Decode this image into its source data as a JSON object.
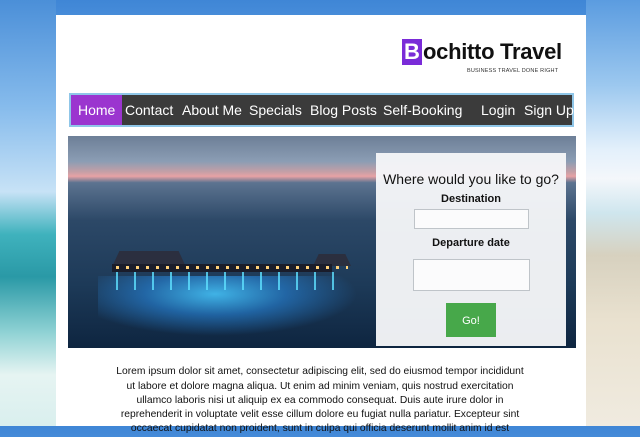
{
  "brand": {
    "initial": "B",
    "name": "ochitto Travel",
    "tagline": "BUSINESS TRAVEL DONE RIGHT",
    "colors": {
      "accent": "#7a2bd8"
    }
  },
  "nav": {
    "items": [
      "Home",
      "Contact",
      "About Me",
      "Specials",
      "Blog Posts",
      "Self-Booking"
    ],
    "right_items": [
      "Login",
      "Sign Up"
    ],
    "active": "Home",
    "colors": {
      "bar": "#3b3b3b",
      "active": "#9b35cf",
      "border": "#8fc6e8"
    }
  },
  "booking": {
    "title": "Where would you like to go?",
    "destination_label": "Destination",
    "destination_value": "",
    "departure_label": "Departure date",
    "departure_value": "",
    "go_label": "Go!",
    "colors": {
      "go": "#47a84a"
    }
  },
  "content": {
    "paragraph": "Lorem ipsum dolor sit amet, consectetur adipiscing elit, sed do eiusmod tempor incididunt ut labore et dolore magna aliqua. Ut enim ad minim veniam, quis nostrud exercitation ullamco laboris nisi ut aliquip ex ea commodo consequat. Duis aute irure dolor in reprehenderit in voluptate velit esse cillum dolore eu fugiat nulla pariatur. Excepteur sint occaecat cupidatat non proident, sunt in culpa qui officia deserunt mollit anim id est"
  }
}
